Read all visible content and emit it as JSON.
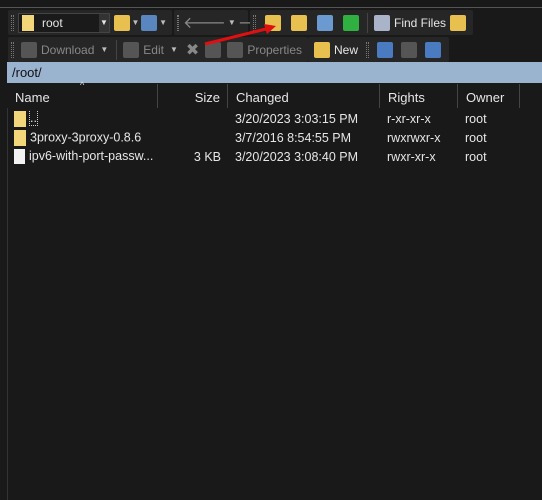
{
  "toolbar1": {
    "location": "root",
    "find_files": "Find Files"
  },
  "toolbar2": {
    "download": "Download",
    "edit": "Edit",
    "properties": "Properties",
    "new": "New"
  },
  "path": "/root/",
  "columns": {
    "name": "Name",
    "size": "Size",
    "changed": "Changed",
    "rights": "Rights",
    "owner": "Owner"
  },
  "files": [
    {
      "name": "..",
      "size": "",
      "changed": "3/20/2023 3:03:15 PM",
      "rights": "r-xr-xr-x",
      "owner": "root",
      "icon": "parent-folder-icon"
    },
    {
      "name": "3proxy-3proxy-0.8.6",
      "size": "",
      "changed": "3/7/2016 8:54:55 PM",
      "rights": "rwxrwxr-x",
      "owner": "root",
      "icon": "folder-icon"
    },
    {
      "name": "ipv6-with-port-passw...",
      "size": "3 KB",
      "changed": "3/20/2023 3:08:40 PM",
      "rights": "rwxr-xr-x",
      "owner": "root",
      "icon": "file-icon"
    }
  ],
  "colors": {
    "path_bar": "#9ab3cf",
    "folder": "#f4d67a",
    "annotation_arrow": "#e01010"
  }
}
